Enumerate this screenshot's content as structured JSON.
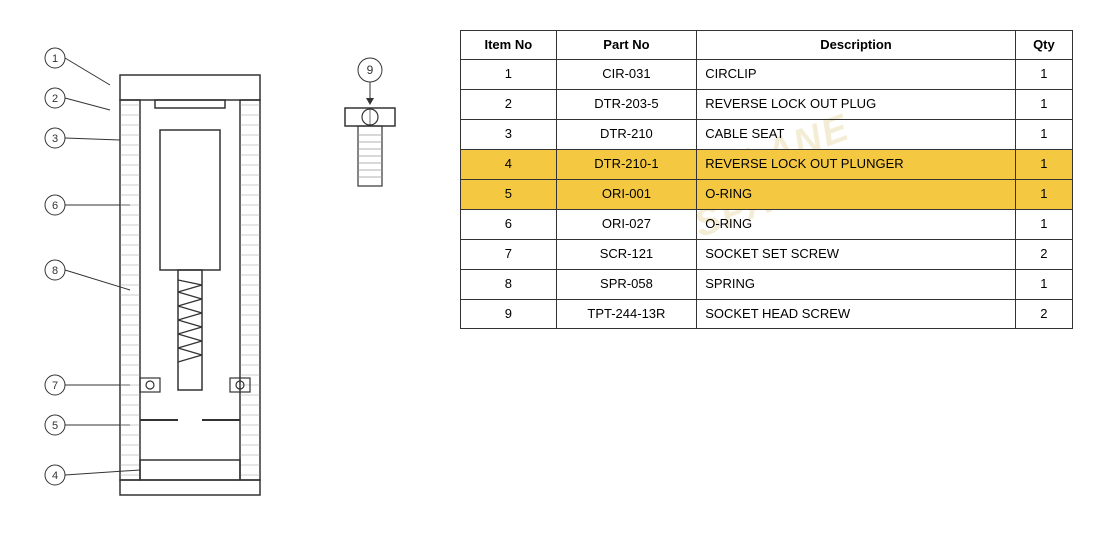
{
  "table": {
    "headers": {
      "item_no": "Item No",
      "part_no": "Part No",
      "description": "Description",
      "qty": "Qty"
    },
    "rows": [
      {
        "item": "1",
        "part": "CIR-031",
        "description": "CIRCLIP",
        "qty": "1",
        "highlight": false
      },
      {
        "item": "2",
        "part": "DTR-203-5",
        "description": "REVERSE LOCK OUT PLUG",
        "qty": "1",
        "highlight": false
      },
      {
        "item": "3",
        "part": "DTR-210",
        "description": "CABLE SEAT",
        "qty": "1",
        "highlight": false
      },
      {
        "item": "4",
        "part": "DTR-210-1",
        "description": "REVERSE LOCK OUT PLUNGER",
        "qty": "1",
        "highlight": true
      },
      {
        "item": "5",
        "part": "ORI-001",
        "description": "O-RING",
        "qty": "1",
        "highlight": true
      },
      {
        "item": "6",
        "part": "ORI-027",
        "description": "O-RING",
        "qty": "1",
        "highlight": false
      },
      {
        "item": "7",
        "part": "SCR-121",
        "description": "SOCKET SET SCREW",
        "qty": "2",
        "highlight": false
      },
      {
        "item": "8",
        "part": "SPR-058",
        "description": "SPRING",
        "qty": "1",
        "highlight": false
      },
      {
        "item": "9",
        "part": "TPT-244-13R",
        "description": "SOCKET HEAD SCREW",
        "qty": "2",
        "highlight": false
      }
    ]
  },
  "watermark": {
    "line1": "PIT LANE",
    "line2": "SPARES"
  }
}
